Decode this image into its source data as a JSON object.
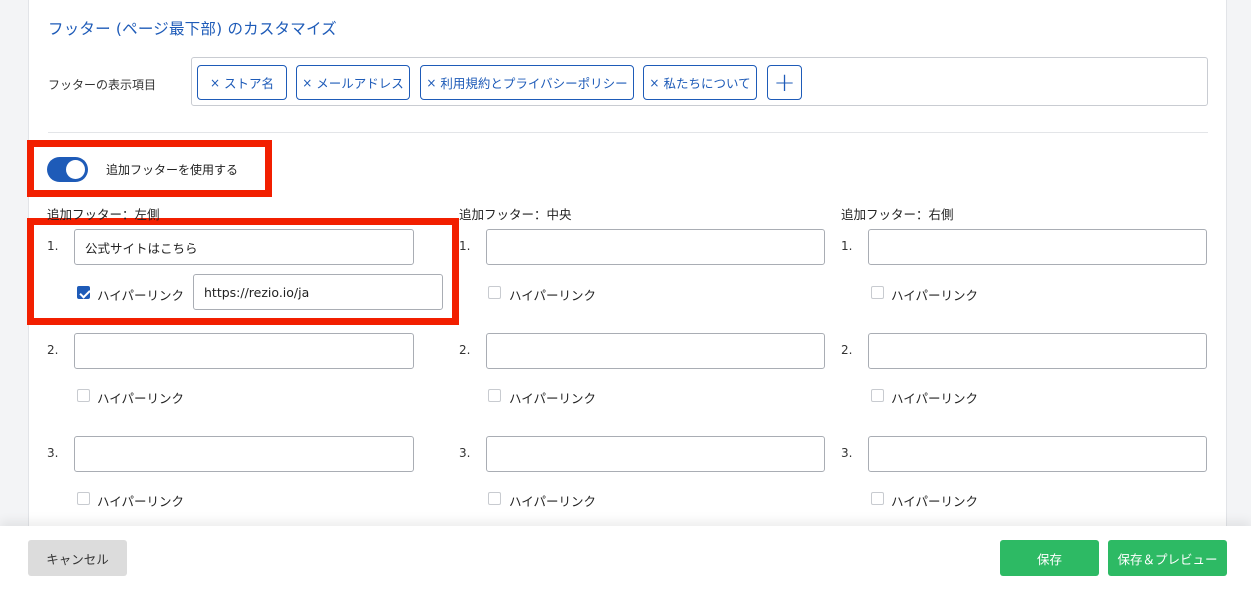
{
  "section_title": "フッター (ページ最下部) のカスタマイズ",
  "footer_items": {
    "label": "フッターの表示項目",
    "tags": [
      "ストア名",
      "メールアドレス",
      "利用規約とプライバシーポリシー",
      "私たちについて"
    ],
    "remove_glyph": "×",
    "add_glyph": "+"
  },
  "extra_footer": {
    "toggle_label": "追加フッターを使用する",
    "enabled": true,
    "columns": [
      {
        "title": "追加フッター：左側",
        "rows": [
          {
            "number": "1.",
            "text": "公式サイトはこちら",
            "hyperlink_label": "ハイパーリンク",
            "hyperlink_checked": true,
            "url": "https://rezio.io/ja"
          },
          {
            "number": "2.",
            "text": "",
            "hyperlink_label": "ハイパーリンク",
            "hyperlink_checked": false
          },
          {
            "number": "3.",
            "text": "",
            "hyperlink_label": "ハイパーリンク",
            "hyperlink_checked": false
          }
        ]
      },
      {
        "title": "追加フッター：中央",
        "rows": [
          {
            "number": "1.",
            "text": "",
            "hyperlink_label": "ハイパーリンク",
            "hyperlink_checked": false
          },
          {
            "number": "2.",
            "text": "",
            "hyperlink_label": "ハイパーリンク",
            "hyperlink_checked": false
          },
          {
            "number": "3.",
            "text": "",
            "hyperlink_label": "ハイパーリンク",
            "hyperlink_checked": false
          }
        ]
      },
      {
        "title": "追加フッター：右側",
        "rows": [
          {
            "number": "1.",
            "text": "",
            "hyperlink_label": "ハイパーリンク",
            "hyperlink_checked": false
          },
          {
            "number": "2.",
            "text": "",
            "hyperlink_label": "ハイパーリンク",
            "hyperlink_checked": false
          },
          {
            "number": "3.",
            "text": "",
            "hyperlink_label": "ハイパーリンク",
            "hyperlink_checked": false
          }
        ]
      }
    ]
  },
  "actions": {
    "cancel_label": "キャンセル",
    "save_label": "保存",
    "save_preview_label": "保存＆プレビュー"
  },
  "colors": {
    "accent": "#1e5bb8",
    "highlight": "#f21f00",
    "save": "#2dba64",
    "cancel": "#dcdcdc"
  }
}
